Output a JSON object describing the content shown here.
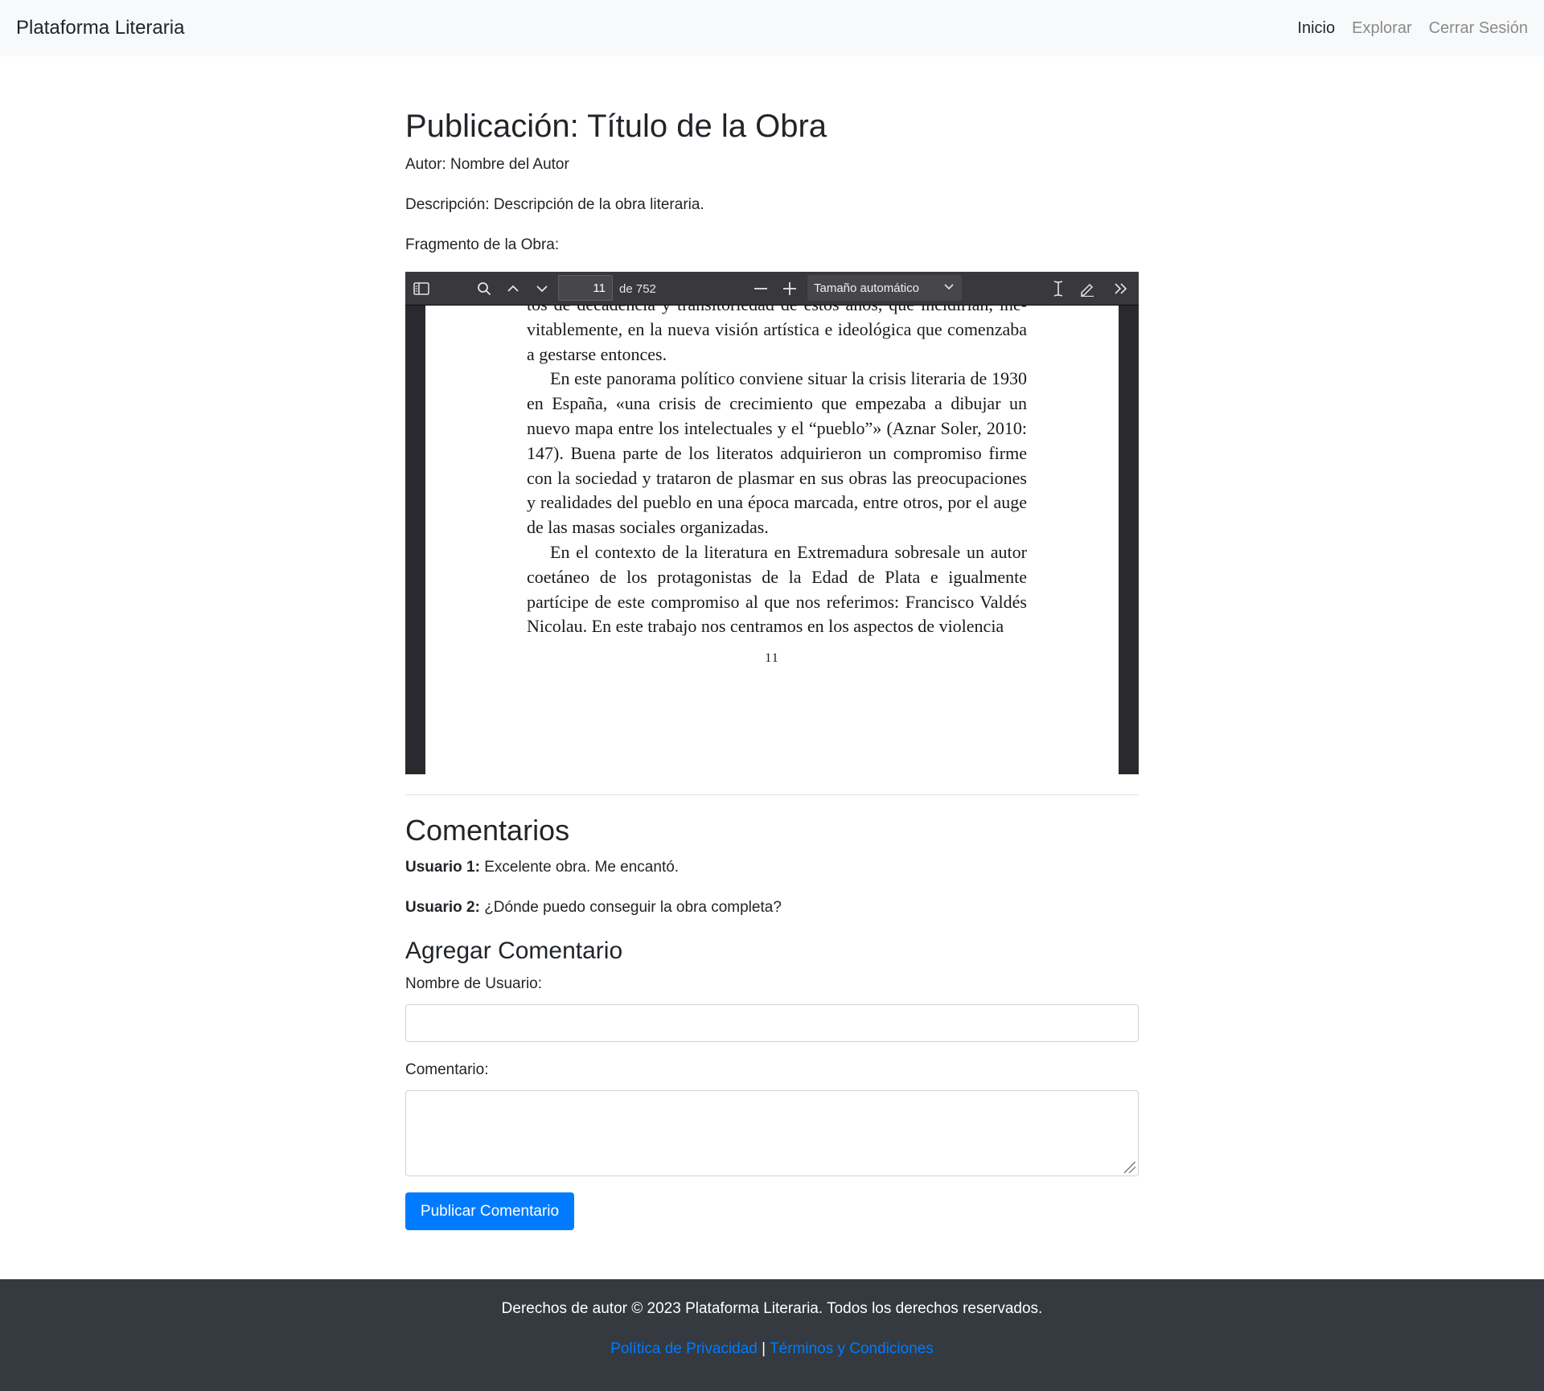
{
  "navbar": {
    "brand": "Plataforma Literaria",
    "links": [
      "Inicio",
      "Explorar",
      "Cerrar Sesión"
    ]
  },
  "publication": {
    "title": "Publicación: Título de la Obra",
    "author": "Autor: Nombre del Autor",
    "description": "Descripción: Descripción de la obra literaria.",
    "fragment_label": "Fragmento de la Obra:"
  },
  "pdf_viewer": {
    "current_page": "11",
    "total_pages": "de 752",
    "zoom": "Tamaño automático",
    "icons": [
      "sidebar-toggle-icon",
      "search-icon",
      "previous-page-icon",
      "next-page-icon",
      "zoom-out-icon",
      "zoom-in-icon",
      "text-cursor-icon",
      "draw-icon",
      "tools-icon"
    ],
    "lines": [
      "tos de decadencia y transitoriedad de estos años, que incidirían, ine-",
      "vitablemente, en la nueva visión artística e ideológica que comenzaba",
      "a gestarse entonces.",
      "En este panorama político conviene situar la crisis literaria de 1930 en España, «una crisis de crecimiento que empezaba a dibujar un nuevo mapa entre los intelectuales y el “pueblo”» (Aznar Soler, 2010: 147). Buena parte de los literatos adquirieron un compromiso firme con la sociedad y trataron de plasmar en sus obras las preocupaciones y realidades del pueblo en una época marcada, entre otros, por el auge de las masas sociales organizadas.",
      "En el contexto de la literatura en Extremadura sobresale un autor coetáneo de los protagonistas de la Edad de Plata e igualmente partícipe de este compromiso al que nos referimos: Francisco Valdés Nicolau. En este trabajo nos centramos en los aspectos de violencia"
    ],
    "page_number": "11"
  },
  "comments": {
    "heading": "Comentarios",
    "items": [
      {
        "user": "Usuario 1:",
        "text": " Excelente obra. Me encantó."
      },
      {
        "user": "Usuario 2:",
        "text": " ¿Dónde puedo conseguir la obra completa?"
      }
    ]
  },
  "form": {
    "heading": "Agregar Comentario",
    "username_label": "Nombre de Usuario:",
    "username_value": "",
    "comment_label": "Comentario:",
    "comment_value": "",
    "submit": "Publicar Comentario"
  },
  "footer": {
    "copyright": "Derechos de autor © 2023 Plataforma Literaria. Todos los derechos reservados.",
    "privacy": "Política de Privacidad",
    "separator": " | ",
    "terms": "Términos y Condiciones"
  },
  "colors": {
    "primary": "#007bff",
    "navbar_bg": "#f8f9fa",
    "footer_bg": "#343a40",
    "viewer_bg": "#2a2a2e",
    "toolbar_bg": "#38383d"
  }
}
